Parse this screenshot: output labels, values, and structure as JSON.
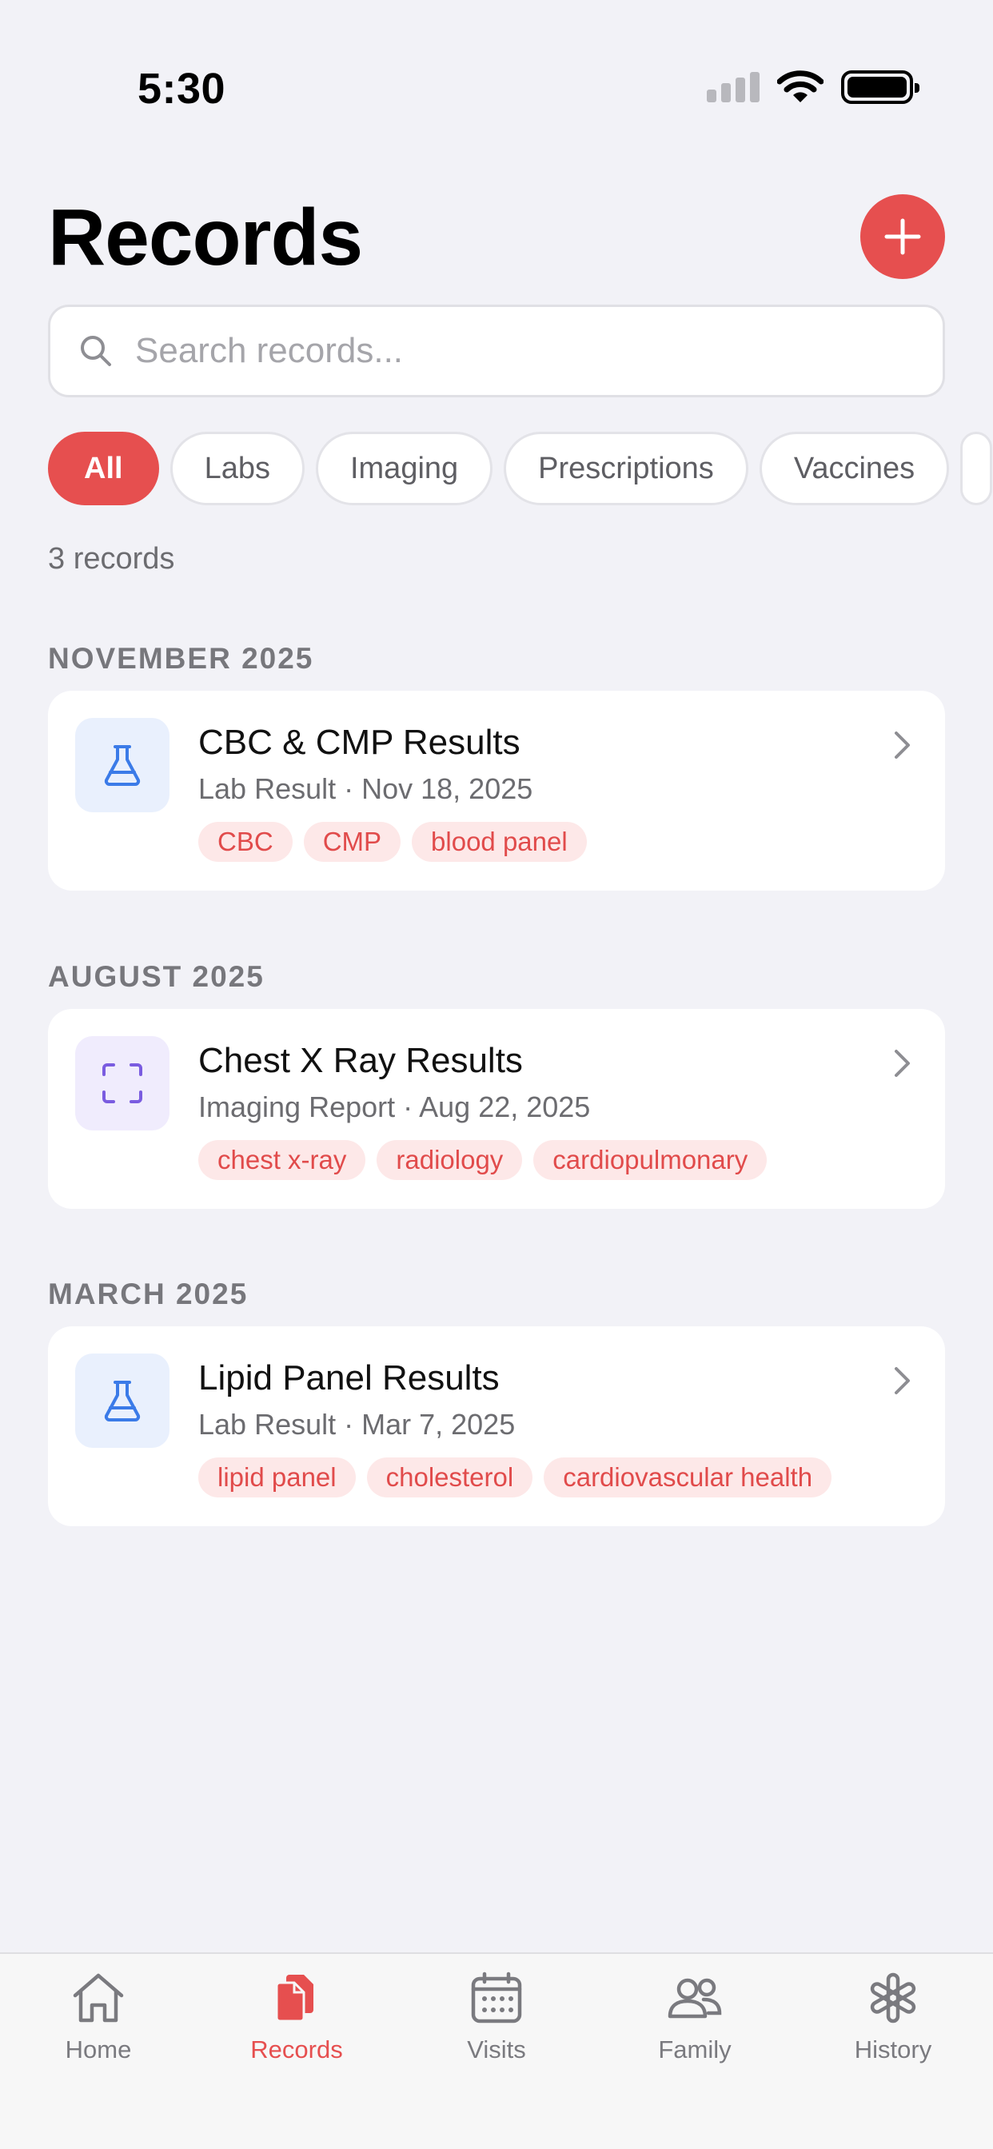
{
  "status_bar": {
    "time": "5:30"
  },
  "header": {
    "title": "Records"
  },
  "search": {
    "placeholder": "Search records..."
  },
  "filters": [
    "All",
    "Labs",
    "Imaging",
    "Prescriptions",
    "Vaccines"
  ],
  "active_filter": "All",
  "record_count": "3 records",
  "sections": [
    {
      "title": "NOVEMBER 2025",
      "records": [
        {
          "icon": "flask-icon",
          "title": "CBC & CMP Results",
          "subtitle": "Lab Result · Nov 18, 2025",
          "tags": [
            "CBC",
            "CMP",
            "blood panel"
          ]
        }
      ]
    },
    {
      "title": "AUGUST 2025",
      "records": [
        {
          "icon": "scan-icon",
          "title": "Chest X Ray Results",
          "subtitle": "Imaging Report · Aug 22, 2025",
          "tags": [
            "chest x-ray",
            "radiology",
            "cardiopulmonary"
          ]
        }
      ]
    },
    {
      "title": "MARCH 2025",
      "records": [
        {
          "icon": "flask-icon",
          "title": "Lipid Panel Results",
          "subtitle": "Lab Result · Mar 7, 2025",
          "tags": [
            "lipid panel",
            "cholesterol",
            "cardiovascular health"
          ]
        }
      ]
    }
  ],
  "tab_bar": [
    {
      "label": "Home",
      "icon": "home-icon"
    },
    {
      "label": "Records",
      "icon": "records-icon",
      "active": true
    },
    {
      "label": "Visits",
      "icon": "calendar-icon"
    },
    {
      "label": "Family",
      "icon": "people-icon"
    },
    {
      "label": "History",
      "icon": "asterisk-icon"
    }
  ],
  "colors": {
    "accent": "#e64f4f",
    "background": "#f2f2f7",
    "lab_icon": "#3b7be8",
    "imaging_icon": "#7a5ce0",
    "tag_bg": "#fde8e8"
  }
}
